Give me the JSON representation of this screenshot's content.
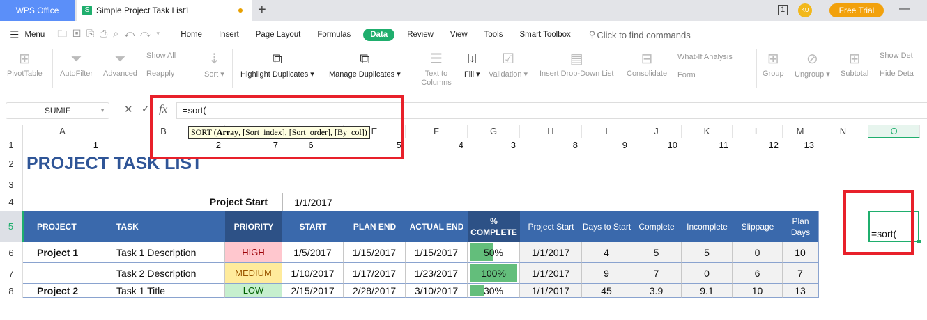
{
  "tabs": {
    "app": "WPS Office",
    "doc": "Simple Project Task List1",
    "new": "+"
  },
  "titlebar": {
    "user_initials": "KU",
    "free_trial": "Free Trial",
    "window_count": "1"
  },
  "menu": {
    "menu_label": "Menu",
    "items": [
      "Home",
      "Insert",
      "Page Layout",
      "Formulas",
      "Data",
      "Review",
      "View",
      "Tools",
      "Smart Toolbox"
    ],
    "active": "Data",
    "search_placeholder": "Click to find commands"
  },
  "ribbon": {
    "pivot": "PivotTable",
    "autofilter": "AutoFilter",
    "advanced": "Advanced",
    "show_all": "Show All",
    "reapply": "Reapply",
    "sort": "Sort",
    "highlight_dup": "Highlight Duplicates",
    "manage_dup": "Manage Duplicates",
    "text_to_columns": "Text to Columns",
    "fill": "Fill",
    "validation": "Validation",
    "dropdown": "Insert Drop-Down List",
    "consolidate": "Consolidate",
    "whatif": "What-If Analysis",
    "form": "Form",
    "group": "Group",
    "ungroup": "Ungroup",
    "subtotal": "Subtotal",
    "show_detail": "Show Det",
    "hide_detail": "Hide Deta"
  },
  "formula_bar": {
    "name_box": "SUMIF",
    "fx": "fx",
    "formula": "=sort(",
    "tooltip_fn": "SORT (",
    "tooltip_arg1": "Array",
    "tooltip_rest": ", [Sort_index], [Sort_order], [By_col])"
  },
  "columns": [
    "A",
    "B",
    "C",
    "D",
    "E",
    "F",
    "G",
    "H",
    "I",
    "J",
    "K",
    "L",
    "M",
    "N",
    "O"
  ],
  "rows": [
    "1",
    "2",
    "3",
    "4",
    "5",
    "6",
    "7",
    "8"
  ],
  "row1": [
    "1",
    "2",
    "7",
    "6",
    "5",
    "4",
    "3",
    "8",
    "9",
    "10",
    "11",
    "12",
    "13"
  ],
  "title": "PROJECT TASK LIST",
  "project_start_label": "Project Start",
  "project_start_value": "1/1/2017",
  "headers": [
    "PROJECT",
    "TASK",
    "PRIORITY",
    "START",
    "PLAN END",
    "ACTUAL END",
    "% COMPLETE",
    "Project Start",
    "Days to Start",
    "Complete",
    "Incomplete",
    "Slippage",
    "Plan Days"
  ],
  "table": [
    {
      "project": "Project 1",
      "task": "Task 1 Description",
      "priority": "HIGH",
      "start": "1/5/2017",
      "plan_end": "1/15/2017",
      "actual_end": "1/15/2017",
      "pct": "50%",
      "pct_value": 50,
      "pstart": "1/1/2017",
      "days": "4",
      "complete": "5",
      "incomplete": "5",
      "slip": "0",
      "plan_days": "10"
    },
    {
      "project": "",
      "task": "Task 2 Description",
      "priority": "MEDIUM",
      "start": "1/10/2017",
      "plan_end": "1/17/2017",
      "actual_end": "1/23/2017",
      "pct": "100%",
      "pct_value": 100,
      "pstart": "1/1/2017",
      "days": "9",
      "complete": "7",
      "incomplete": "0",
      "slip": "6",
      "plan_days": "7"
    },
    {
      "project": "Project 2",
      "task": "Task 1 Title",
      "priority": "LOW",
      "start": "2/15/2017",
      "plan_end": "2/28/2017",
      "actual_end": "3/10/2017",
      "pct": "30%",
      "pct_value": 30,
      "pstart": "1/1/2017",
      "days": "45",
      "complete": "3.9",
      "incomplete": "9.1",
      "slip": "10",
      "plan_days": "13"
    }
  ],
  "active_cell": {
    "ref": "O5",
    "value": "=sort("
  },
  "colors": {
    "header": "#3a69ac",
    "accent": "#1fae6d",
    "high": "#ffc7ce",
    "medium": "#ffeb9c",
    "low": "#c6efce",
    "bar": "#63be7b",
    "annotation": "#e8202a"
  }
}
